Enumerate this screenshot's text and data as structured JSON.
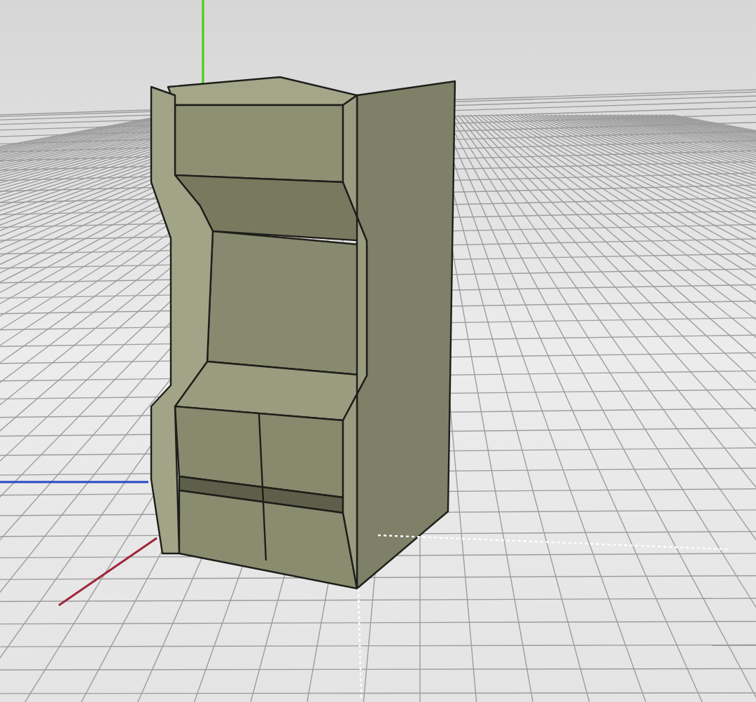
{
  "viewport": {
    "axes": [
      {
        "kind": "x",
        "color": "#a0283c"
      },
      {
        "kind": "y",
        "color": "#4ccc1a"
      },
      {
        "kind": "z",
        "color": "#2848c8"
      }
    ]
  }
}
